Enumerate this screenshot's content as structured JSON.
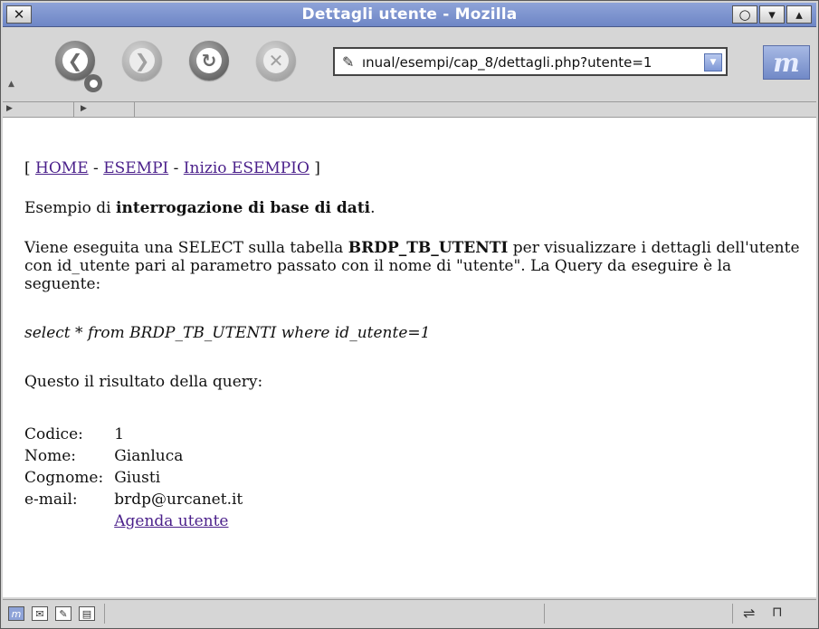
{
  "window": {
    "title": "Dettagli utente - Mozilla",
    "close_glyph": "✕",
    "restore_glyph": "○",
    "menu_glyph": "▾",
    "maximize_glyph": "▴"
  },
  "toolbar": {
    "back_glyph": "❮",
    "forward_glyph": "❯",
    "reload_glyph": "↻",
    "stop_glyph": "✕",
    "url": "ınual/esempi/cap_8/dettagli.php?utente=1",
    "url_icon": "✎",
    "logo_letter": "m"
  },
  "page": {
    "breadcrumb": {
      "open": "[ ",
      "home": "HOME",
      "sep1": " - ",
      "esempi": "ESEMPI",
      "sep2": " - ",
      "inizio": "Inizio ESEMPIO",
      "close": " ]"
    },
    "intro_pre": "Esempio di ",
    "intro_bold": "interrogazione di base di dati",
    "intro_post": ".",
    "desc_pre": "Viene eseguita una SELECT sulla tabella ",
    "desc_bold": "BRDP_TB_UTENTI",
    "desc_post": " per visualizzare i dettagli dell'utente con id_utente pari al parametro passato con il nome di \"utente\". La Query da eseguire è la seguente:",
    "query": "select * from BRDP_TB_UTENTI where id_utente=1",
    "result_label": "Questo il risultato della query:",
    "rows": [
      {
        "label": "Codice:",
        "value": "1"
      },
      {
        "label": "Nome:",
        "value": "Gianluca"
      },
      {
        "label": "Cognome:",
        "value": "Giusti"
      },
      {
        "label": "e-mail:",
        "value": "brdp@urcanet.it"
      }
    ],
    "agenda_link": "Agenda utente"
  },
  "statusbar": {
    "icons": [
      "mozilla-icon",
      "mail-icon",
      "composer-icon",
      "addressbook-icon"
    ],
    "online_glyph": "⇌",
    "lock_glyph": "🔓"
  },
  "colors": {
    "titlebar": "#7a90cc",
    "link": "#4a1f8a"
  }
}
